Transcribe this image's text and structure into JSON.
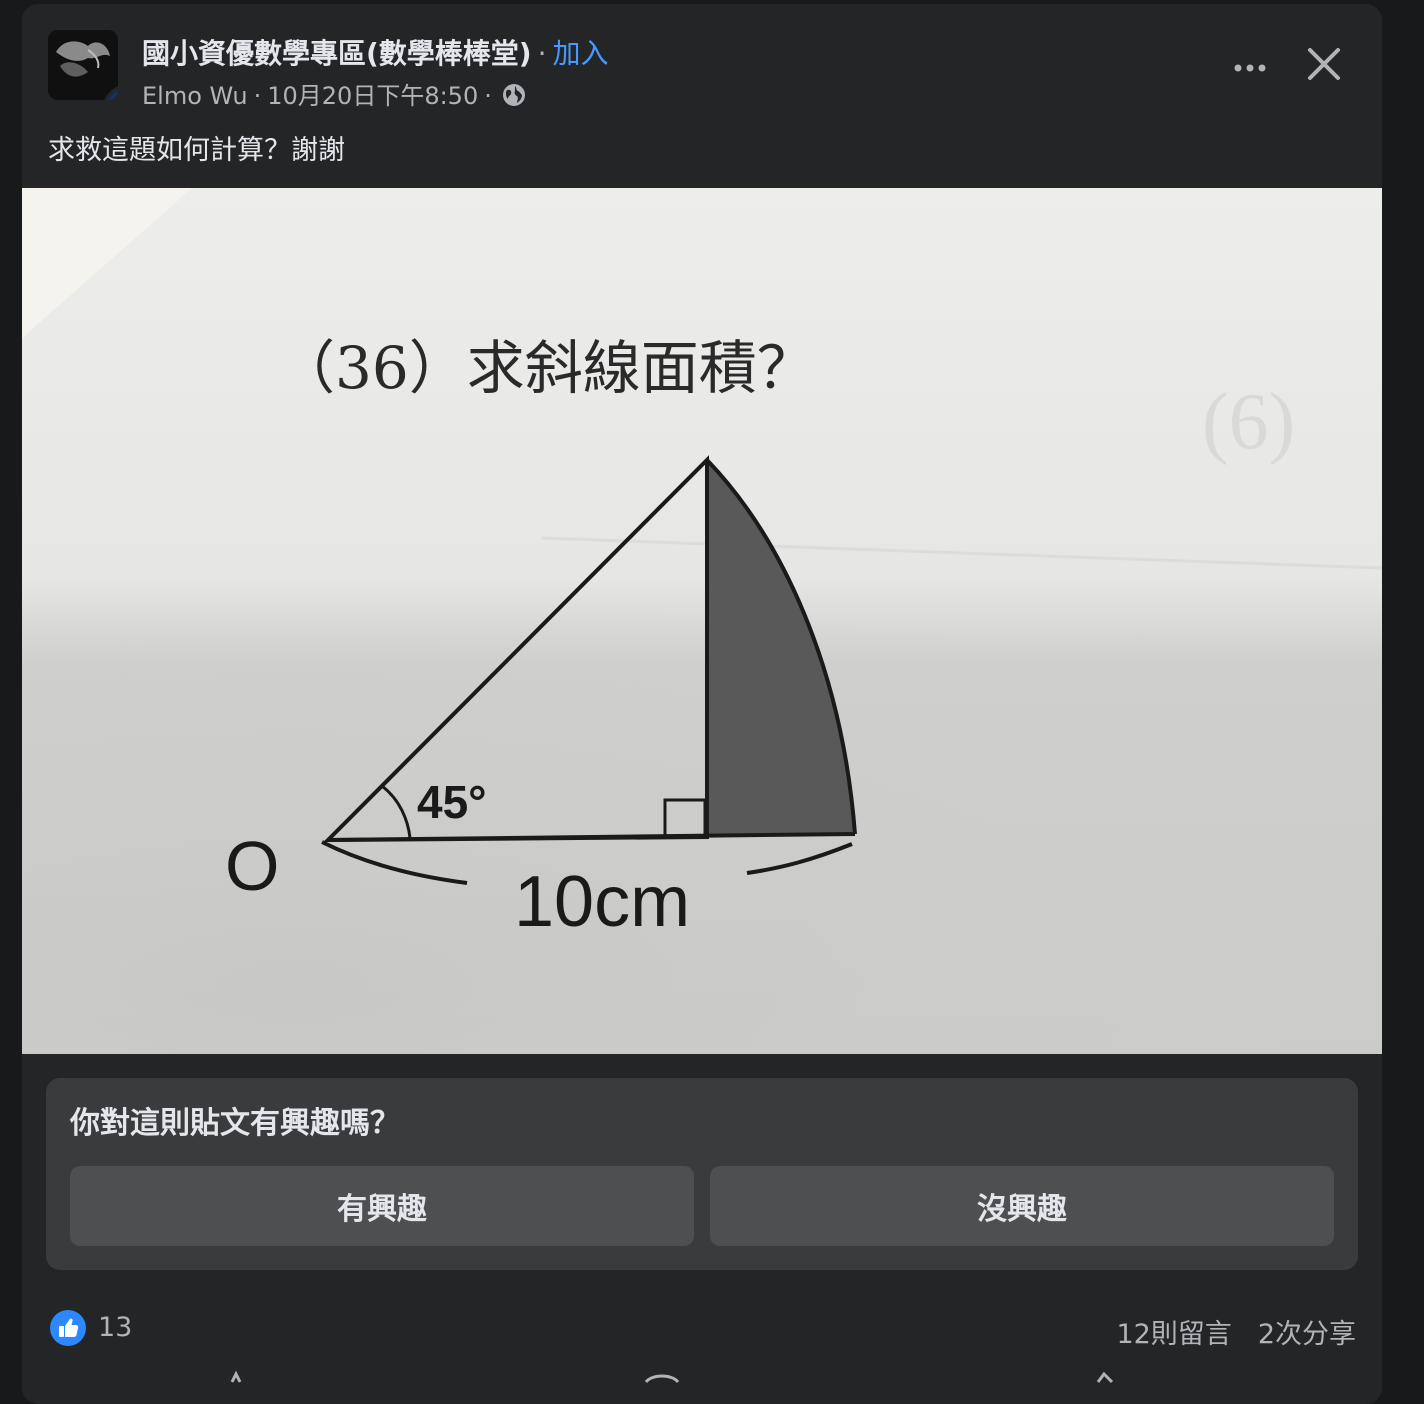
{
  "post": {
    "group_name": "國小資優數學專區(數學棒棒堂)",
    "join_label": "加入",
    "author": "Elmo Wu",
    "timestamp": "10月20日下午8:50",
    "audience_icon": "globe-icon",
    "text": "求救這題如何計算？謝謝"
  },
  "photo": {
    "problem_title": "（36）求斜線面積？",
    "angle_label": "45°",
    "vertex_label": "O",
    "length_label": "10cm"
  },
  "interest_prompt": {
    "question": "你對這則貼文有興趣嗎？",
    "yes_label": "有興趣",
    "no_label": "沒興趣"
  },
  "reactions": {
    "like_count": "13",
    "comments": "12則留言",
    "shares": "2次分享"
  },
  "colors": {
    "card_bg": "#242526",
    "accent": "#4599ff",
    "like_blue": "#2d88ff"
  }
}
